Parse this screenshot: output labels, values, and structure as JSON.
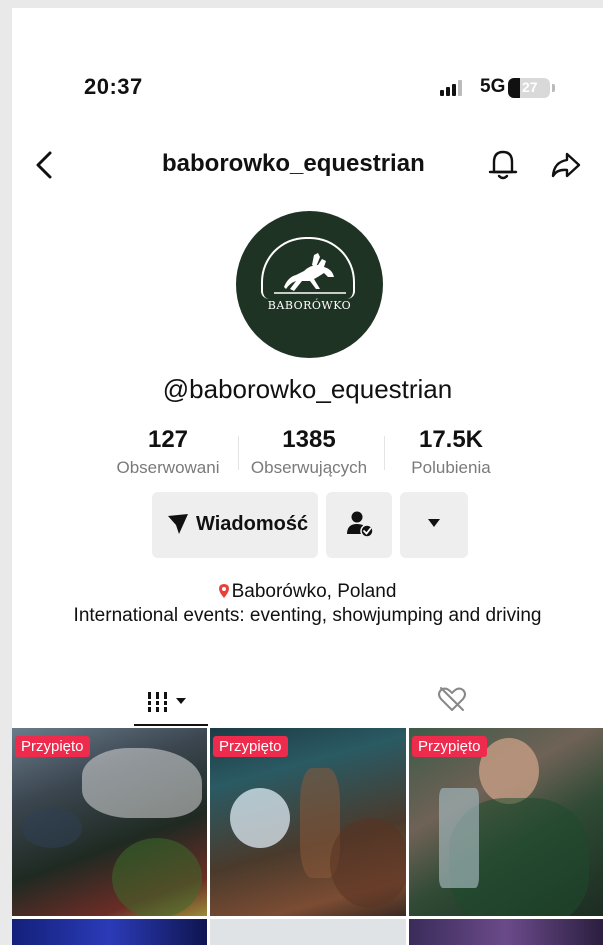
{
  "status_bar": {
    "time": "20:37",
    "network": "5G",
    "battery": "27"
  },
  "header": {
    "title": "baborowko_equestrian",
    "icons": [
      "back-arrow-icon",
      "bell-icon",
      "share-icon"
    ]
  },
  "profile": {
    "avatar_text": "BABORÓWKO",
    "handle": "@baborowko_equestrian",
    "stats": [
      {
        "value": "127",
        "label": "Obserwowani"
      },
      {
        "value": "1385",
        "label": "Obserwujących"
      },
      {
        "value": "17.5K",
        "label": "Polubienia"
      }
    ],
    "buttons": {
      "message": "Wiadomość"
    },
    "location": "Baborówko, Poland",
    "bio": "International events: eventing, showjumping and driving"
  },
  "tabs": {
    "icons": [
      "grid-icon",
      "liked-hidden-icon"
    ]
  },
  "videos": [
    {
      "badge": "Przypięto"
    },
    {
      "badge": "Przypięto"
    },
    {
      "badge": "Przypięto"
    }
  ],
  "colors": {
    "accent": "#ee2a4d",
    "avatar_bg": "#1f3324",
    "button_bg": "#eeeeee"
  }
}
